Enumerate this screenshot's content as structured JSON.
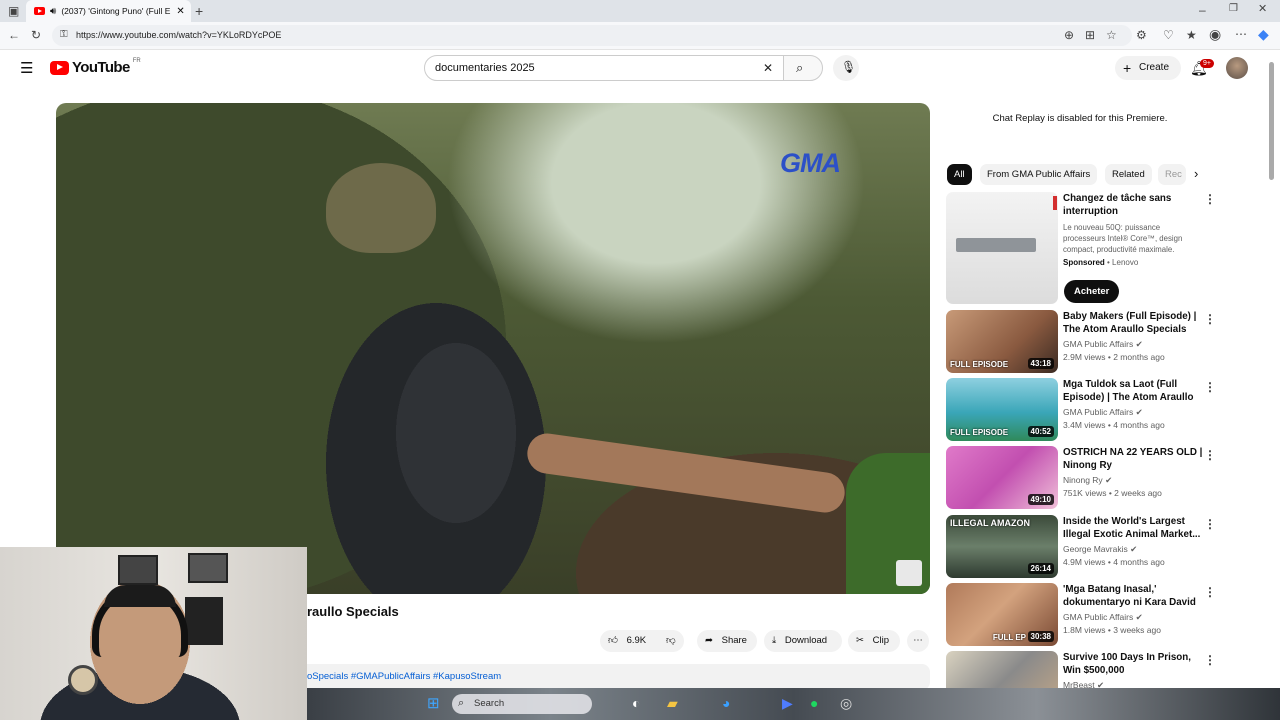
{
  "browser": {
    "tab_title": "(2037) 'Gintong Puno' (Full E",
    "url": "https://www.youtube.com/watch?v=YKLoRDYcPOE"
  },
  "header": {
    "logo_text": "YouTube",
    "region": "FR",
    "search_value": "documentaries 2025",
    "create_label": "Create",
    "notif_count": "9+"
  },
  "video": {
    "watermark": "GMA",
    "title_visible": "raullo Specials",
    "hashtags": "oSpecials #GMAPublicAffairs #KapusoStream"
  },
  "actions": {
    "likes": "6.9K",
    "share": "Share",
    "download": "Download",
    "clip": "Clip"
  },
  "sidebar": {
    "chat_note": "Chat Replay is disabled for this Premiere.",
    "chips": [
      "All",
      "From GMA Public Affairs",
      "Related",
      "Rec"
    ],
    "ad": {
      "title": "Changez de tâche sans interruption",
      "desc": "Le nouveau 50Q: puissance processeurs Intel® Core™, design compact, productivité maximale.",
      "sponsored": "Sponsored",
      "sponsor": "Lenovo",
      "cta": "Acheter"
    },
    "recs": [
      {
        "title": "Baby Makers (Full Episode) | The Atom Araullo Specials",
        "channel": "GMA Public Affairs",
        "meta": "2.9M views • 2 months ago",
        "duration": "43:18",
        "badge": "FULL EPISODE",
        "verified": true
      },
      {
        "title": "Mga Tuldok sa Laot (Full Episode) | The Atom Araullo ...",
        "channel": "GMA Public Affairs",
        "meta": "3.4M views • 4 months ago",
        "duration": "40:52",
        "badge": "FULL EPISODE",
        "verified": true
      },
      {
        "title": "OSTRICH NA 22 YEARS OLD | Ninong Ry",
        "channel": "Ninong Ry",
        "meta": "751K views • 2 weeks ago",
        "duration": "49:10",
        "badge": "",
        "verified": true
      },
      {
        "title": "Inside the World's Largest Illegal Exotic Animal Market...",
        "channel": "George Mavrakis",
        "meta": "4.9M views • 4 months ago",
        "duration": "26:14",
        "badge": "ILLEGAL AMAZON",
        "verified": true
      },
      {
        "title": "'Mga Batang Inasal,' dokumentaryo ni Kara David ...",
        "channel": "GMA Public Affairs",
        "meta": "1.8M views • 3 weeks ago",
        "duration": "30:38",
        "badge": "FULL EP",
        "verified": true
      },
      {
        "title": "Survive 100 Days In Prison, Win $500,000",
        "channel": "MrBeast",
        "meta": "",
        "duration": "",
        "badge": "",
        "verified": true
      }
    ]
  },
  "taskbar": {
    "search_placeholder": "Search"
  }
}
